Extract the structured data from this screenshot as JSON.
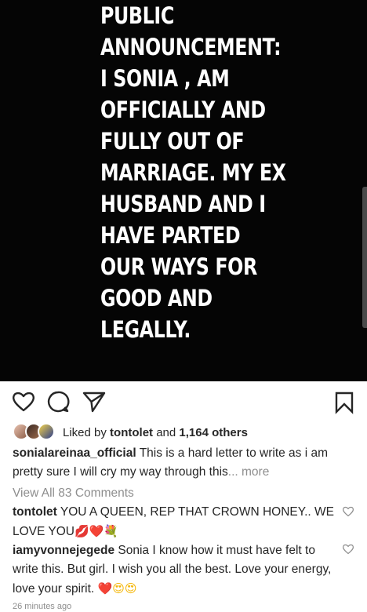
{
  "post": {
    "announcement_lines": [
      "PUBLIC",
      "ANNOUNCEMENT:",
      "I SONIA , AM",
      "OFFICIALLY AND",
      "FULLY OUT OF",
      "MARRIAGE. MY EX",
      "HUSBAND AND I",
      "HAVE PARTED",
      "OUR WAYS FOR",
      "GOOD AND",
      "LEGALLY."
    ]
  },
  "actions": {
    "like_icon": "heart-outline-icon",
    "comment_icon": "comment-bubble-icon",
    "share_icon": "paper-plane-icon",
    "save_icon": "bookmark-icon"
  },
  "likes": {
    "prefix": "Liked by",
    "user": "tontolet",
    "connector": "and",
    "others": "1,164 others"
  },
  "caption": {
    "username": "sonialareinaa_official",
    "text": "This is a hard letter to write as i am pretty sure I will cry my way through this",
    "more_label": "... more"
  },
  "view_all_comments": "View All 83 Comments",
  "comments": [
    {
      "username": "tontolet",
      "text": "YOU A QUEEN,  REP THAT CROWN HONEY.. WE LOVE YOU",
      "emojis": [
        "💋",
        "❤️",
        "💐"
      ]
    },
    {
      "username": "iamyvonnejegede",
      "text": "Sonia I know how it must have felt to write this. But girl. I wish you all the best. Love your energy, love your spirit.",
      "emojis": [
        "❤️",
        "😍",
        "😍"
      ]
    }
  ],
  "timestamp": "26 minutes ago",
  "colors": {
    "image_bg": "#050505",
    "text": "#262626",
    "muted": "#8e8e8e",
    "heart_red": "#e0245e"
  }
}
